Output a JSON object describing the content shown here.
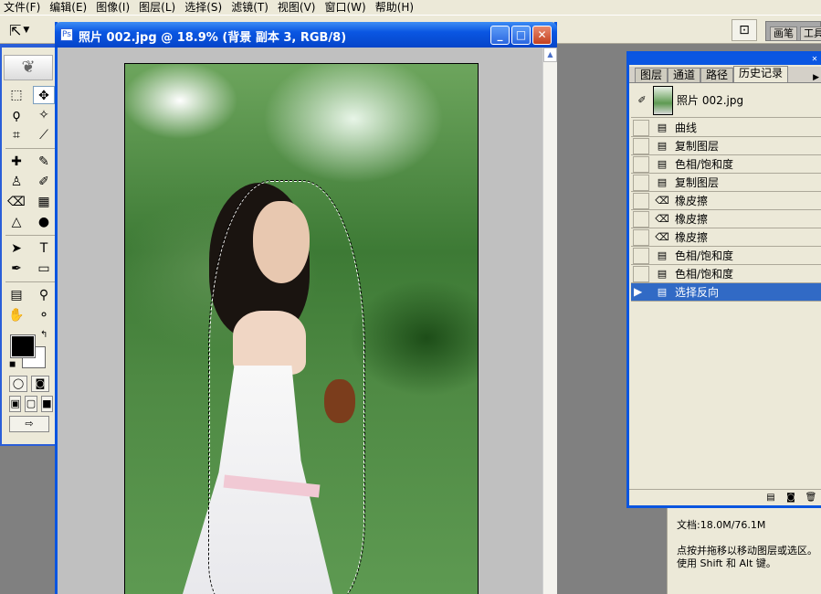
{
  "menubar": {
    "items": [
      "文件(F)",
      "编辑(E)",
      "图像(I)",
      "图层(L)",
      "选择(S)",
      "滤镜(T)",
      "视图(V)",
      "窗口(W)",
      "帮助(H)"
    ]
  },
  "options_bar": {
    "tool_icon": "move-tool-icon",
    "palette_well_tabs": [
      "画笔",
      "工具"
    ]
  },
  "toolbox": {
    "tools": [
      "rect-marquee-icon",
      "move-icon",
      "lasso-icon",
      "magic-wand-icon",
      "crop-icon",
      "slice-icon",
      "healing-icon",
      "brush-icon",
      "stamp-icon",
      "history-brush-icon",
      "eraser-icon",
      "gradient-icon",
      "blur-icon",
      "dodge-icon",
      "path-select-icon",
      "type-icon",
      "pen-icon",
      "shape-icon",
      "notes-icon",
      "eyedropper-icon",
      "hand-icon",
      "zoom-icon"
    ],
    "foreground_color": "#000000",
    "background_color": "#ffffff"
  },
  "document": {
    "title": "照片 002.jpg @ 18.9% (背景 副本 3, RGB/8)"
  },
  "history": {
    "tabs": [
      "图层",
      "通道",
      "路径",
      "历史记录"
    ],
    "snapshot_label": "照片 002.jpg",
    "steps": [
      {
        "label": "曲线",
        "icon": "step-doc-icon"
      },
      {
        "label": "复制图层",
        "icon": "step-doc-icon"
      },
      {
        "label": "色相/饱和度",
        "icon": "step-doc-icon"
      },
      {
        "label": "复制图层",
        "icon": "step-doc-icon"
      },
      {
        "label": "橡皮擦",
        "icon": "eraser-icon"
      },
      {
        "label": "橡皮擦",
        "icon": "eraser-icon"
      },
      {
        "label": "橡皮擦",
        "icon": "eraser-icon"
      },
      {
        "label": "色相/饱和度",
        "icon": "step-doc-icon"
      },
      {
        "label": "色相/饱和度",
        "icon": "step-doc-icon"
      },
      {
        "label": "选择反向",
        "icon": "step-doc-icon",
        "selected": true
      }
    ],
    "selection_color": "#316ac5"
  },
  "info": {
    "doc_size": "文档:18.0M/76.1M",
    "hint_line1": "点按并拖移以移动图层或选区。",
    "hint_line2": "使用 Shift 和 Alt 键。"
  }
}
